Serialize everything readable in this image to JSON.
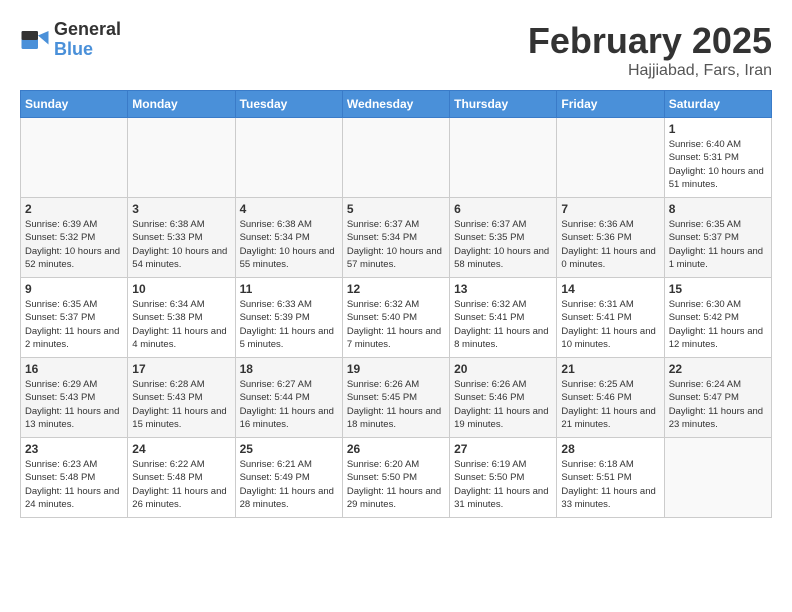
{
  "header": {
    "logo_general": "General",
    "logo_blue": "Blue",
    "month_title": "February 2025",
    "location": "Hajjiabad, Fars, Iran"
  },
  "weekdays": [
    "Sunday",
    "Monday",
    "Tuesday",
    "Wednesday",
    "Thursday",
    "Friday",
    "Saturday"
  ],
  "weeks": [
    [
      {
        "day": "",
        "info": ""
      },
      {
        "day": "",
        "info": ""
      },
      {
        "day": "",
        "info": ""
      },
      {
        "day": "",
        "info": ""
      },
      {
        "day": "",
        "info": ""
      },
      {
        "day": "",
        "info": ""
      },
      {
        "day": "1",
        "info": "Sunrise: 6:40 AM\nSunset: 5:31 PM\nDaylight: 10 hours and 51 minutes."
      }
    ],
    [
      {
        "day": "2",
        "info": "Sunrise: 6:39 AM\nSunset: 5:32 PM\nDaylight: 10 hours and 52 minutes."
      },
      {
        "day": "3",
        "info": "Sunrise: 6:38 AM\nSunset: 5:33 PM\nDaylight: 10 hours and 54 minutes."
      },
      {
        "day": "4",
        "info": "Sunrise: 6:38 AM\nSunset: 5:34 PM\nDaylight: 10 hours and 55 minutes."
      },
      {
        "day": "5",
        "info": "Sunrise: 6:37 AM\nSunset: 5:34 PM\nDaylight: 10 hours and 57 minutes."
      },
      {
        "day": "6",
        "info": "Sunrise: 6:37 AM\nSunset: 5:35 PM\nDaylight: 10 hours and 58 minutes."
      },
      {
        "day": "7",
        "info": "Sunrise: 6:36 AM\nSunset: 5:36 PM\nDaylight: 11 hours and 0 minutes."
      },
      {
        "day": "8",
        "info": "Sunrise: 6:35 AM\nSunset: 5:37 PM\nDaylight: 11 hours and 1 minute."
      }
    ],
    [
      {
        "day": "9",
        "info": "Sunrise: 6:35 AM\nSunset: 5:37 PM\nDaylight: 11 hours and 2 minutes."
      },
      {
        "day": "10",
        "info": "Sunrise: 6:34 AM\nSunset: 5:38 PM\nDaylight: 11 hours and 4 minutes."
      },
      {
        "day": "11",
        "info": "Sunrise: 6:33 AM\nSunset: 5:39 PM\nDaylight: 11 hours and 5 minutes."
      },
      {
        "day": "12",
        "info": "Sunrise: 6:32 AM\nSunset: 5:40 PM\nDaylight: 11 hours and 7 minutes."
      },
      {
        "day": "13",
        "info": "Sunrise: 6:32 AM\nSunset: 5:41 PM\nDaylight: 11 hours and 8 minutes."
      },
      {
        "day": "14",
        "info": "Sunrise: 6:31 AM\nSunset: 5:41 PM\nDaylight: 11 hours and 10 minutes."
      },
      {
        "day": "15",
        "info": "Sunrise: 6:30 AM\nSunset: 5:42 PM\nDaylight: 11 hours and 12 minutes."
      }
    ],
    [
      {
        "day": "16",
        "info": "Sunrise: 6:29 AM\nSunset: 5:43 PM\nDaylight: 11 hours and 13 minutes."
      },
      {
        "day": "17",
        "info": "Sunrise: 6:28 AM\nSunset: 5:43 PM\nDaylight: 11 hours and 15 minutes."
      },
      {
        "day": "18",
        "info": "Sunrise: 6:27 AM\nSunset: 5:44 PM\nDaylight: 11 hours and 16 minutes."
      },
      {
        "day": "19",
        "info": "Sunrise: 6:26 AM\nSunset: 5:45 PM\nDaylight: 11 hours and 18 minutes."
      },
      {
        "day": "20",
        "info": "Sunrise: 6:26 AM\nSunset: 5:46 PM\nDaylight: 11 hours and 19 minutes."
      },
      {
        "day": "21",
        "info": "Sunrise: 6:25 AM\nSunset: 5:46 PM\nDaylight: 11 hours and 21 minutes."
      },
      {
        "day": "22",
        "info": "Sunrise: 6:24 AM\nSunset: 5:47 PM\nDaylight: 11 hours and 23 minutes."
      }
    ],
    [
      {
        "day": "23",
        "info": "Sunrise: 6:23 AM\nSunset: 5:48 PM\nDaylight: 11 hours and 24 minutes."
      },
      {
        "day": "24",
        "info": "Sunrise: 6:22 AM\nSunset: 5:48 PM\nDaylight: 11 hours and 26 minutes."
      },
      {
        "day": "25",
        "info": "Sunrise: 6:21 AM\nSunset: 5:49 PM\nDaylight: 11 hours and 28 minutes."
      },
      {
        "day": "26",
        "info": "Sunrise: 6:20 AM\nSunset: 5:50 PM\nDaylight: 11 hours and 29 minutes."
      },
      {
        "day": "27",
        "info": "Sunrise: 6:19 AM\nSunset: 5:50 PM\nDaylight: 11 hours and 31 minutes."
      },
      {
        "day": "28",
        "info": "Sunrise: 6:18 AM\nSunset: 5:51 PM\nDaylight: 11 hours and 33 minutes."
      },
      {
        "day": "",
        "info": ""
      }
    ]
  ]
}
